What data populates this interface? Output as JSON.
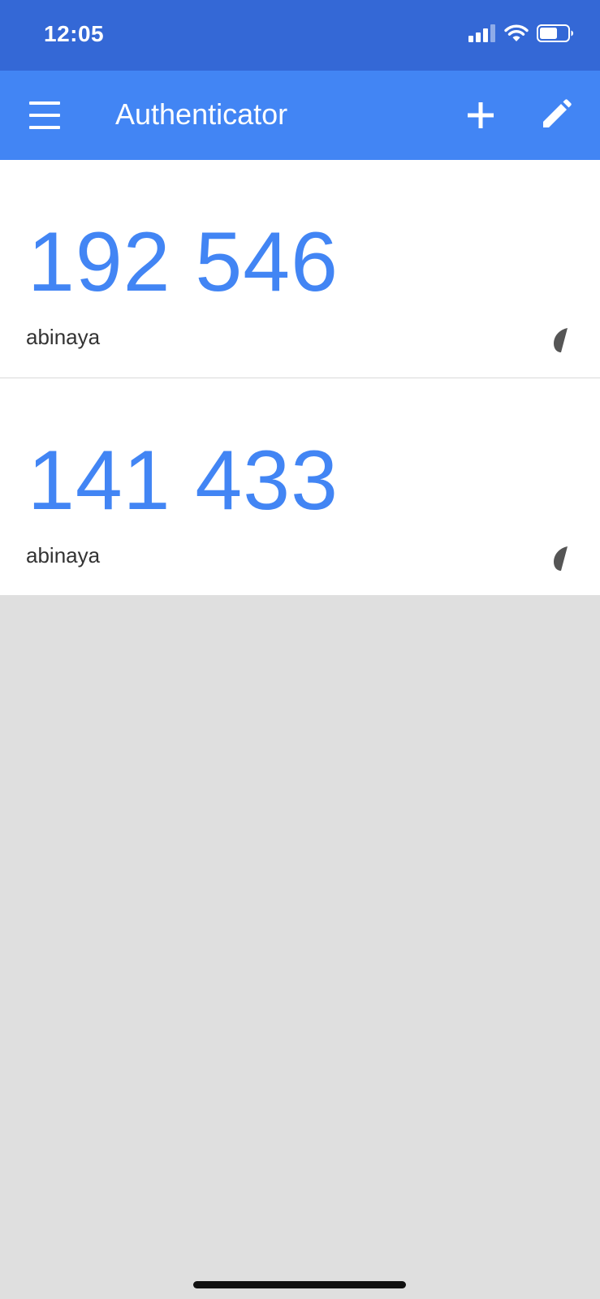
{
  "status_bar": {
    "time": "12:05",
    "icons": [
      "cellular-signal-icon",
      "wifi-icon",
      "battery-icon"
    ]
  },
  "app_bar": {
    "menu_icon": "hamburger-menu-icon",
    "title": "Authenticator",
    "add_icon": "plus-icon",
    "edit_icon": "pencil-icon"
  },
  "accounts": [
    {
      "code": "192 546",
      "name": "abinaya",
      "timer_icon": "countdown-timer-icon"
    },
    {
      "code": "141 433",
      "name": "abinaya",
      "timer_icon": "countdown-timer-icon"
    }
  ],
  "colors": {
    "status_bar": "#3468d6",
    "app_bar": "#4285f4",
    "code_text": "#4285f4",
    "background": "#dfdfdf",
    "timer": "#555555"
  }
}
